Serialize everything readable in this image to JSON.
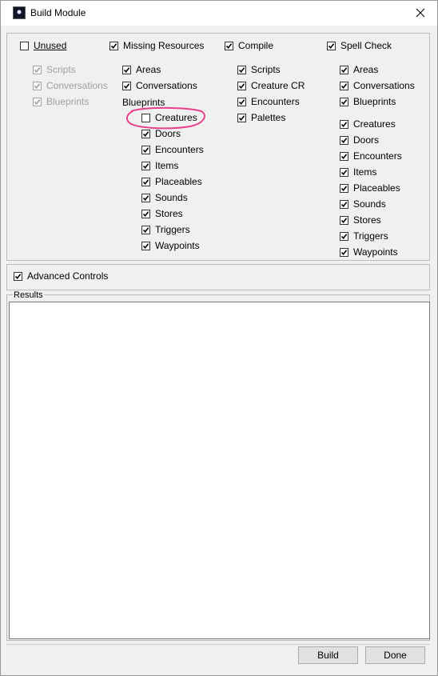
{
  "window": {
    "title": "Build Module"
  },
  "unused": {
    "label": "Unused",
    "checked": false,
    "scripts": "Scripts",
    "conversations": "Conversations",
    "blueprints": "Blueprints"
  },
  "missing": {
    "label": "Missing Resources",
    "checked": true,
    "areas": "Areas",
    "conversations": "Conversations",
    "blueprints_header": "Blueprints",
    "creatures": "Creatures",
    "doors": "Doors",
    "encounters": "Encounters",
    "items": "Items",
    "placeables": "Placeables",
    "sounds": "Sounds",
    "stores": "Stores",
    "triggers": "Triggers",
    "waypoints": "Waypoints"
  },
  "compile": {
    "label": "Compile",
    "checked": true,
    "scripts": "Scripts",
    "creature_cr": "Creature CR",
    "encounters": "Encounters",
    "palettes": "Palettes"
  },
  "spell": {
    "label": "Spell Check",
    "checked": true,
    "areas": "Areas",
    "conversations": "Conversations",
    "blueprints": "Blueprints",
    "creatures": "Creatures",
    "doors": "Doors",
    "encounters": "Encounters",
    "items": "Items",
    "placeables": "Placeables",
    "sounds": "Sounds",
    "stores": "Stores",
    "triggers": "Triggers",
    "waypoints": "Waypoints"
  },
  "advanced": {
    "label": "Advanced Controls",
    "checked": true
  },
  "results": {
    "label": "Results"
  },
  "buttons": {
    "build": "Build",
    "done": "Done"
  },
  "colors": {
    "annotation": "#e8408a",
    "check": "#000000",
    "disabled_check": "#a0a0a0"
  }
}
